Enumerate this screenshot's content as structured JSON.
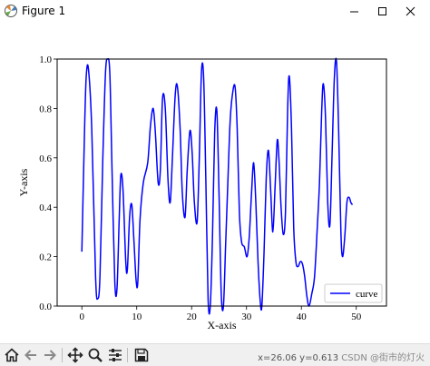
{
  "window": {
    "title": "Figure 1"
  },
  "toolbar": {
    "buttons": [
      "home-icon",
      "back-arrow-icon",
      "forward-arrow-icon",
      "pan-icon",
      "zoom-icon",
      "configure-subplots-icon",
      "save-icon"
    ],
    "coordinates_text": "x=26.06 y=0.613"
  },
  "watermark": "CSDN @街市的灯火",
  "chart_data": {
    "type": "line",
    "title": "",
    "xlabel": "X-axis",
    "ylabel": "Y-axis",
    "xlim": [
      -4.5,
      55.5
    ],
    "ylim": [
      0.0,
      1.0
    ],
    "xticks": [
      0,
      10,
      20,
      30,
      40,
      50
    ],
    "yticks": [
      0.0,
      0.2,
      0.4,
      0.6,
      0.8,
      1.0
    ],
    "ytick_labels": [
      "0.0",
      "0.2",
      "0.4",
      "0.6",
      "0.8",
      "1.0"
    ],
    "grid": false,
    "legend": {
      "position": "lower-right",
      "entries": [
        "curve"
      ]
    },
    "series": [
      {
        "name": "curve",
        "color": "#0000ff",
        "x": [
          0.0,
          0.5,
          0.8,
          1.2,
          1.8,
          2.5,
          2.9,
          3.3,
          3.8,
          4.3,
          4.7,
          5.1,
          5.5,
          6.0,
          6.4,
          6.8,
          7.1,
          7.5,
          8.0,
          8.3,
          8.7,
          9.1,
          9.5,
          9.9,
          10.2,
          10.6,
          11.2,
          12.0,
          12.5,
          13.0,
          13.4,
          13.9,
          14.3,
          14.7,
          15.2,
          15.7,
          16.1,
          16.5,
          17.0,
          17.4,
          17.9,
          18.3,
          18.8,
          19.2,
          19.7,
          20.1,
          20.5,
          21.0,
          21.4,
          21.8,
          22.2,
          22.6,
          23.0,
          23.4,
          23.8,
          24.2,
          24.6,
          25.0,
          25.4,
          25.8,
          26.2,
          26.6,
          27.0,
          27.4,
          27.9,
          28.3,
          28.7,
          29.1,
          29.6,
          30.1,
          30.5,
          30.9,
          31.3,
          31.7,
          32.1,
          32.5,
          32.8,
          33.2,
          33.6,
          34.0,
          34.4,
          34.8,
          35.2,
          35.6,
          35.9,
          36.3,
          36.7,
          37.1,
          37.5,
          37.8,
          38.2,
          38.6,
          39.0,
          39.4,
          39.8,
          40.2,
          40.6,
          41.0,
          41.4,
          41.9,
          42.4,
          42.9,
          43.3,
          43.7,
          44.0,
          44.4,
          44.8,
          45.2,
          45.6,
          46.0,
          46.4,
          46.8,
          47.2,
          47.5,
          47.9,
          48.3,
          48.7,
          49.0,
          49.3
        ],
        "y": [
          0.22,
          0.72,
          0.93,
          0.96,
          0.72,
          0.12,
          0.03,
          0.12,
          0.58,
          0.94,
          1.0,
          0.94,
          0.55,
          0.1,
          0.07,
          0.35,
          0.53,
          0.47,
          0.18,
          0.15,
          0.36,
          0.41,
          0.26,
          0.1,
          0.1,
          0.35,
          0.5,
          0.58,
          0.73,
          0.8,
          0.7,
          0.5,
          0.55,
          0.84,
          0.8,
          0.51,
          0.42,
          0.6,
          0.85,
          0.89,
          0.72,
          0.46,
          0.36,
          0.55,
          0.71,
          0.62,
          0.42,
          0.34,
          0.6,
          0.95,
          0.92,
          0.5,
          0.03,
          0.0,
          0.28,
          0.7,
          0.79,
          0.45,
          0.05,
          0.0,
          0.25,
          0.5,
          0.74,
          0.85,
          0.89,
          0.72,
          0.38,
          0.26,
          0.24,
          0.2,
          0.28,
          0.45,
          0.58,
          0.42,
          0.18,
          0.02,
          0.0,
          0.22,
          0.52,
          0.63,
          0.47,
          0.3,
          0.48,
          0.67,
          0.6,
          0.4,
          0.29,
          0.38,
          0.8,
          0.93,
          0.72,
          0.32,
          0.18,
          0.16,
          0.18,
          0.17,
          0.12,
          0.04,
          0.0,
          0.05,
          0.12,
          0.32,
          0.5,
          0.79,
          0.9,
          0.76,
          0.42,
          0.33,
          0.62,
          0.92,
          0.99,
          0.7,
          0.3,
          0.2,
          0.28,
          0.42,
          0.44,
          0.42,
          0.41
        ]
      }
    ]
  }
}
